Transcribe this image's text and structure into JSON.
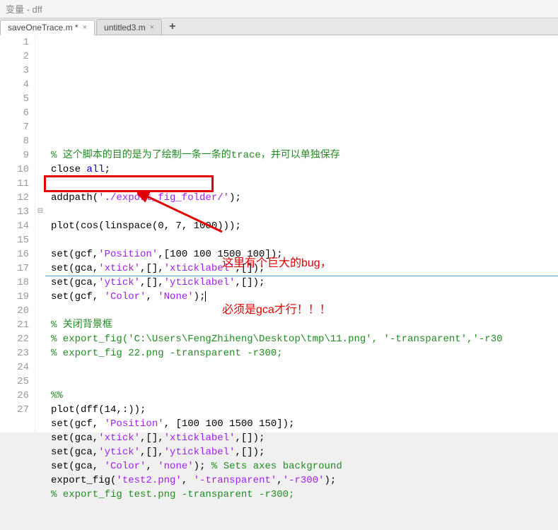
{
  "header": {
    "title": "变量 - dff"
  },
  "tabs": {
    "items": [
      {
        "label": "saveOneTrace.m *",
        "active": true
      },
      {
        "label": "untitled3.m",
        "active": false
      }
    ],
    "add_label": "+"
  },
  "code": {
    "lines": [
      {
        "n": 1,
        "tokens": [
          [
            "comment",
            "% 这个脚本的目的是为了绘制一条一条的trace，并可以单独保存"
          ]
        ]
      },
      {
        "n": 2,
        "tokens": [
          [
            "default",
            "close "
          ],
          [
            "keyword",
            "all"
          ],
          [
            "default",
            ";"
          ]
        ]
      },
      {
        "n": 3,
        "tokens": []
      },
      {
        "n": 4,
        "tokens": [
          [
            "default",
            "addpath("
          ],
          [
            "string",
            "'./export_fig_folder/'"
          ],
          [
            "default",
            ");"
          ]
        ]
      },
      {
        "n": 5,
        "tokens": []
      },
      {
        "n": 6,
        "tokens": [
          [
            "default",
            "plot(cos(linspace(0, 7, 1000)));"
          ]
        ]
      },
      {
        "n": 7,
        "tokens": []
      },
      {
        "n": 8,
        "tokens": [
          [
            "default",
            "set(gcf,"
          ],
          [
            "string",
            "'Position'"
          ],
          [
            "default",
            ",[100 100 1500 100]);"
          ]
        ]
      },
      {
        "n": 9,
        "tokens": [
          [
            "default",
            "set(gca,"
          ],
          [
            "string",
            "'xtick'"
          ],
          [
            "default",
            ",[],"
          ],
          [
            "string",
            "'xticklabel'"
          ],
          [
            "default",
            ",[]);"
          ]
        ]
      },
      {
        "n": 10,
        "tokens": [
          [
            "default",
            "set(gca,"
          ],
          [
            "string",
            "'ytick'"
          ],
          [
            "default",
            ",[],"
          ],
          [
            "string",
            "'yticklabel'"
          ],
          [
            "default",
            ",[]);"
          ]
        ]
      },
      {
        "n": 11,
        "tokens": [
          [
            "default",
            "set(gcf, "
          ],
          [
            "string",
            "'Color'"
          ],
          [
            "default",
            ", "
          ],
          [
            "string",
            "'None'"
          ],
          [
            "default",
            ");"
          ]
        ]
      },
      {
        "n": 12,
        "tokens": []
      },
      {
        "n": 13,
        "fold": "[-]",
        "tokens": [
          [
            "comment",
            "% 关闭背景框"
          ]
        ]
      },
      {
        "n": 14,
        "tokens": [
          [
            "comment",
            "% export_fig('C:\\Users\\FengZhiheng\\Desktop\\tmp\\11.png', '-transparent','-r30"
          ]
        ]
      },
      {
        "n": 15,
        "tokens": [
          [
            "comment",
            "% export_fig 22.png -transparent -r300;"
          ]
        ]
      },
      {
        "n": 16,
        "tokens": []
      },
      {
        "n": 17,
        "tokens": []
      },
      {
        "n": 18,
        "tokens": [
          [
            "comment",
            "%%"
          ]
        ]
      },
      {
        "n": 19,
        "tokens": [
          [
            "default",
            "plot(dff(14,:));"
          ]
        ]
      },
      {
        "n": 20,
        "tokens": [
          [
            "default",
            "set(gcf, "
          ],
          [
            "string",
            "'Position'"
          ],
          [
            "default",
            ", [100 100 1500 150]);"
          ]
        ]
      },
      {
        "n": 21,
        "tokens": [
          [
            "default",
            "set(gca,"
          ],
          [
            "string",
            "'xtick'"
          ],
          [
            "default",
            ",[],"
          ],
          [
            "string",
            "'xticklabel'"
          ],
          [
            "default",
            ",[]);"
          ]
        ]
      },
      {
        "n": 22,
        "tokens": [
          [
            "default",
            "set(gca,"
          ],
          [
            "string",
            "'ytick'"
          ],
          [
            "default",
            ",[],"
          ],
          [
            "string",
            "'yticklabel'"
          ],
          [
            "default",
            ",[]);"
          ]
        ]
      },
      {
        "n": 23,
        "tokens": [
          [
            "default",
            "set(gca, "
          ],
          [
            "string",
            "'Color'"
          ],
          [
            "default",
            ", "
          ],
          [
            "string",
            "'none'"
          ],
          [
            "default",
            "); "
          ],
          [
            "comment",
            "% Sets axes background"
          ]
        ]
      },
      {
        "n": 24,
        "tokens": [
          [
            "default",
            "export_fig("
          ],
          [
            "string",
            "'test2.png'"
          ],
          [
            "default",
            ", "
          ],
          [
            "string",
            "'-transparent'"
          ],
          [
            "default",
            ","
          ],
          [
            "string",
            "'-r300'"
          ],
          [
            "default",
            ");"
          ]
        ]
      },
      {
        "n": 25,
        "tokens": [
          [
            "comment",
            "% export_fig test.png -transparent -r300;"
          ]
        ]
      },
      {
        "n": 26,
        "tokens": []
      },
      {
        "n": 27,
        "tokens": []
      }
    ]
  },
  "annotation": {
    "line1": "这里有个巨大的bug，",
    "line2": "必须是gca才行！！！"
  }
}
